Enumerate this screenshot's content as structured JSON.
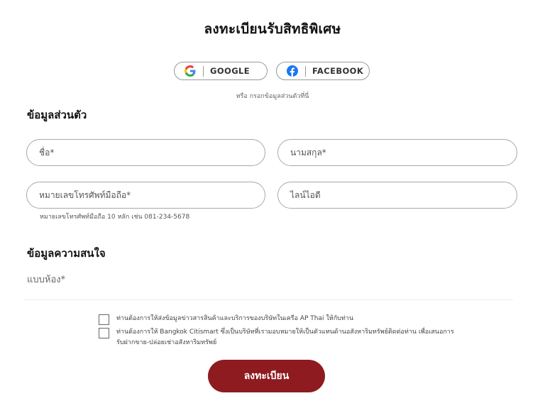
{
  "title": "ลงทะเบียนรับสิทธิพิเศษ",
  "social": {
    "google_label": "GOOGLE",
    "facebook_label": "FACEBOOK",
    "google_icon": "google-icon",
    "facebook_icon": "facebook-icon"
  },
  "or_text": "หรือ กรอกข้อมูลส่วนตัวที่นี่",
  "personal": {
    "heading": "ข้อมูลส่วนตัว",
    "first_name_placeholder": "ชื่อ*",
    "last_name_placeholder": "นามสกุล*",
    "phone_placeholder": "หมายเลขโทรศัพท์มือถือ*",
    "line_placeholder": "ไลน์ไอดี",
    "phone_hint": "หมายเลขโทรศัพท์มือถือ 10 หลัก เช่น 081-234-5678"
  },
  "interest": {
    "heading": "ข้อมูลความสนใจ",
    "room_type_label": "แบบห้อง*"
  },
  "consents": [
    {
      "text": "ท่านต้องการให้ส่งข้อมูลข่าวสารสินค้าและบริการของบริษัทในเครือ AP Thai ให้กับท่าน",
      "checked": false
    },
    {
      "text": "ท่านต้องการให้ Bangkok Citismart ซึ่งเป็นบริษัทที่เรามอบหมายให้เป็นตัวแทนด้านอสังหาริมทรัพย์ติดต่อท่าน เพื่อเสนอการรับฝากขาย-ปล่อยเช่าอสังหาริมทรัพย์",
      "checked": false
    }
  ],
  "submit_label": "ลงทะเบียน",
  "colors": {
    "primary": "#8e1b1f",
    "facebook": "#1877f2"
  }
}
